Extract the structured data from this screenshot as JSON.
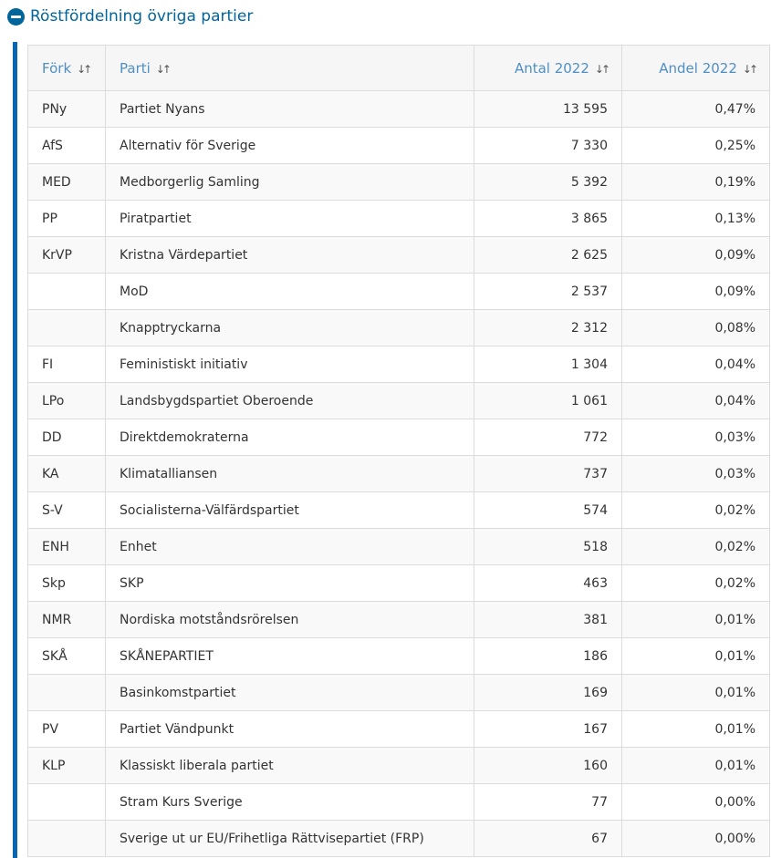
{
  "section": {
    "title": "Röstfördelning övriga partier"
  },
  "table": {
    "columns": [
      {
        "label": "Förk",
        "align": "left"
      },
      {
        "label": "Parti",
        "align": "left"
      },
      {
        "label": "Antal 2022",
        "align": "right"
      },
      {
        "label": "Andel 2022",
        "align": "right"
      }
    ],
    "sort_icon": "sort-arrows-icon",
    "rows": [
      {
        "abbr": "PNy",
        "party": "Partiet Nyans",
        "count": "13 595",
        "share": "0,47%"
      },
      {
        "abbr": "AfS",
        "party": "Alternativ för Sverige",
        "count": "7 330",
        "share": "0,25%"
      },
      {
        "abbr": "MED",
        "party": "Medborgerlig Samling",
        "count": "5 392",
        "share": "0,19%"
      },
      {
        "abbr": "PP",
        "party": "Piratpartiet",
        "count": "3 865",
        "share": "0,13%"
      },
      {
        "abbr": "KrVP",
        "party": "Kristna Värdepartiet",
        "count": "2 625",
        "share": "0,09%"
      },
      {
        "abbr": "",
        "party": "MoD",
        "count": "2 537",
        "share": "0,09%"
      },
      {
        "abbr": "",
        "party": "Knapptryckarna",
        "count": "2 312",
        "share": "0,08%"
      },
      {
        "abbr": "FI",
        "party": "Feministiskt initiativ",
        "count": "1 304",
        "share": "0,04%"
      },
      {
        "abbr": "LPo",
        "party": "Landsbygdspartiet Oberoende",
        "count": "1 061",
        "share": "0,04%"
      },
      {
        "abbr": "DD",
        "party": "Direktdemokraterna",
        "count": "772",
        "share": "0,03%"
      },
      {
        "abbr": "KA",
        "party": "Klimatalliansen",
        "count": "737",
        "share": "0,03%"
      },
      {
        "abbr": "S-V",
        "party": "Socialisterna-Välfärdspartiet",
        "count": "574",
        "share": "0,02%"
      },
      {
        "abbr": "ENH",
        "party": "Enhet",
        "count": "518",
        "share": "0,02%"
      },
      {
        "abbr": "Skp",
        "party": "SKP",
        "count": "463",
        "share": "0,02%"
      },
      {
        "abbr": "NMR",
        "party": "Nordiska motståndsrörelsen",
        "count": "381",
        "share": "0,01%"
      },
      {
        "abbr": "SKÅ",
        "party": "SKÅNEPARTIET",
        "count": "186",
        "share": "0,01%"
      },
      {
        "abbr": "",
        "party": "Basinkomstpartiet",
        "count": "169",
        "share": "0,01%"
      },
      {
        "abbr": "PV",
        "party": "Partiet Vändpunkt",
        "count": "167",
        "share": "0,01%"
      },
      {
        "abbr": "KLP",
        "party": "Klassiskt liberala partiet",
        "count": "160",
        "share": "0,01%"
      },
      {
        "abbr": "",
        "party": "Stram Kurs Sverige",
        "count": "77",
        "share": "0,00%"
      },
      {
        "abbr": "",
        "party": "Sverige ut ur EU/Frihetliga Rättvisepartiet (FRP)",
        "count": "67",
        "share": "0,00%"
      }
    ]
  },
  "colors": {
    "accent": "#00659b",
    "header_text": "#4f8fc3",
    "accent_bar": "#0a66b3"
  }
}
